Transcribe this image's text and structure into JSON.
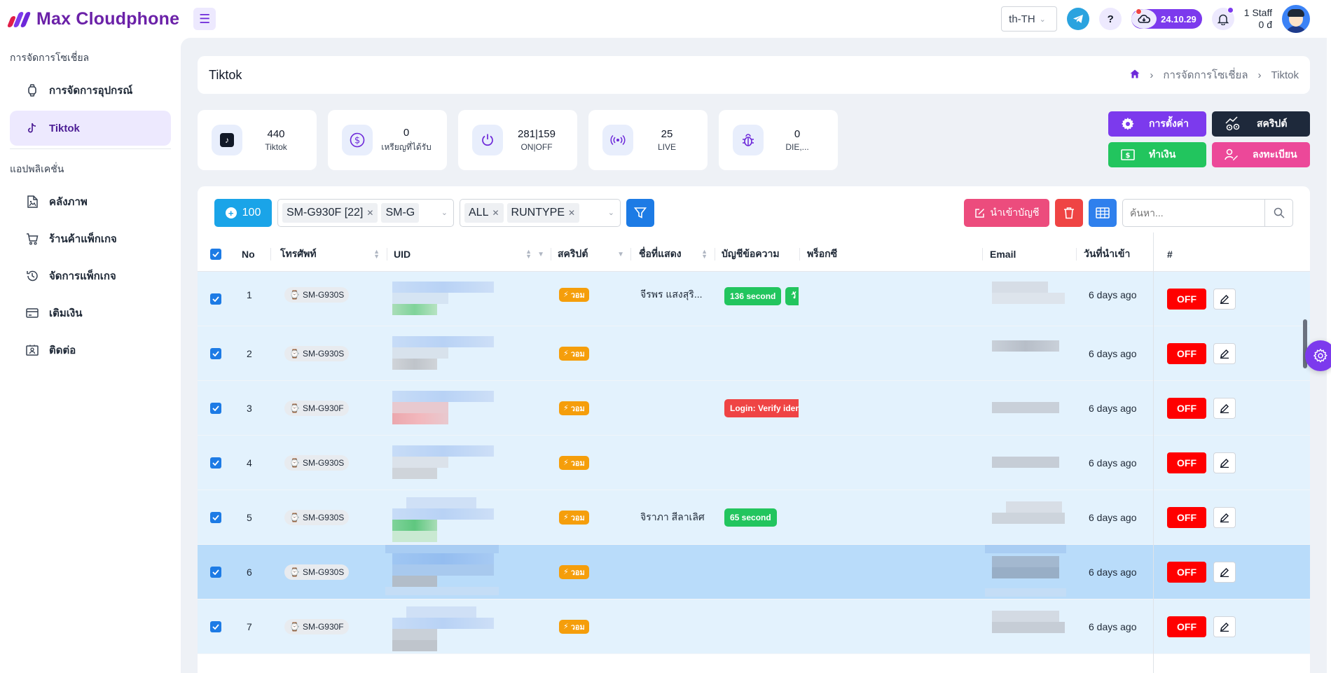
{
  "app": {
    "name": "Max Cloudphone",
    "version": "24.10.29",
    "language": "th-TH"
  },
  "user": {
    "name": "1 Staff",
    "balance": "0 đ"
  },
  "sidebar": {
    "sections": [
      {
        "title": "การจัดการโซเชี่ยล",
        "items": [
          {
            "label": "การจัดการอุปกรณ์",
            "icon": "watch-icon"
          },
          {
            "label": "Tiktok",
            "icon": "tiktok-icon",
            "active": true
          }
        ]
      },
      {
        "title": "แอปพลิเคชั่น",
        "items": [
          {
            "label": "คลังภาพ",
            "icon": "file-image-icon"
          },
          {
            "label": "ร้านค้าแพ็กเกจ",
            "icon": "cart-icon"
          },
          {
            "label": "จัดการแพ็กเกจ",
            "icon": "history-icon"
          },
          {
            "label": "เติมเงิน",
            "icon": "credit-card-icon"
          },
          {
            "label": "ติดต่อ",
            "icon": "contact-icon"
          }
        ]
      }
    ]
  },
  "page": {
    "title": "Tiktok",
    "breadcrumb": [
      "การจัดการโซเชี่ยล",
      "Tiktok"
    ]
  },
  "stats": [
    {
      "value": "440",
      "label": "Tiktok",
      "icon": "tiktok-icon"
    },
    {
      "value": "0",
      "label": "เหรียญที่ได้รับ",
      "icon": "dollar-icon"
    },
    {
      "value": "281|159",
      "label": "ON|OFF",
      "icon": "power-icon"
    },
    {
      "value": "25",
      "label": "LIVE",
      "icon": "broadcast-icon"
    },
    {
      "value": "0",
      "label": "DIE,...",
      "icon": "bug-icon"
    }
  ],
  "actions": {
    "settings": "การตั้งค่า",
    "script": "สคริปต์",
    "earn": "ทำเงิน",
    "register": "ลงทะเบียน"
  },
  "toolbar": {
    "count": "100",
    "device_filters": [
      "SM-G930F [22]",
      "SM-G"
    ],
    "type_filters": [
      "ALL",
      "RUNTYPE"
    ],
    "import_label": "นำเข้าบัญชี",
    "search_placeholder": "ค้นหา..."
  },
  "table": {
    "headers": {
      "no": "No",
      "phone": "โทรศัพท์",
      "uid": "UID",
      "script": "สคริปต์",
      "display_name": "ชื่อที่แสดง",
      "account_message": "บัญชีข้อความ",
      "proxy": "พร็อกซี",
      "email": "Email",
      "imported": "วันที่นำเข้า",
      "actions": "#"
    },
    "rows": [
      {
        "no": "1",
        "device": "SM-G930S",
        "script": "วอม",
        "display_name": "จีรพร แสงสุริ...",
        "message": "136 second",
        "message_color": "green",
        "message_extra": "วั",
        "imported": "6 days ago",
        "status": "OFF",
        "selected": false
      },
      {
        "no": "2",
        "device": "SM-G930S",
        "script": "วอม",
        "display_name": "",
        "message": "",
        "message_color": "",
        "message_extra": "",
        "imported": "6 days ago",
        "status": "OFF",
        "selected": false
      },
      {
        "no": "3",
        "device": "SM-G930F",
        "script": "วอม",
        "display_name": "",
        "message": "Login: Verify iden",
        "message_color": "red",
        "message_extra": "",
        "imported": "6 days ago",
        "status": "OFF",
        "selected": false
      },
      {
        "no": "4",
        "device": "SM-G930S",
        "script": "วอม",
        "display_name": "",
        "message": "",
        "message_color": "",
        "message_extra": "",
        "imported": "6 days ago",
        "status": "OFF",
        "selected": false
      },
      {
        "no": "5",
        "device": "SM-G930S",
        "script": "วอม",
        "display_name": "จิราภา สีลาเลิศ",
        "message": "65 second",
        "message_color": "green",
        "message_extra": "",
        "imported": "6 days ago",
        "status": "OFF",
        "selected": false
      },
      {
        "no": "6",
        "device": "SM-G930S",
        "script": "วอม",
        "display_name": "",
        "message": "",
        "message_color": "",
        "message_extra": "",
        "imported": "6 days ago",
        "status": "OFF",
        "selected": true
      },
      {
        "no": "7",
        "device": "SM-G930F",
        "script": "วอม",
        "display_name": "",
        "message": "",
        "message_color": "",
        "message_extra": "",
        "imported": "6 days ago",
        "status": "OFF",
        "selected": false
      }
    ]
  },
  "colors": {
    "brand": "#6b21a8",
    "accent": "#7c3aed",
    "row_bg": "#e3f2fd",
    "row_selected": "#b9dcfa",
    "off": "#ff0000"
  }
}
